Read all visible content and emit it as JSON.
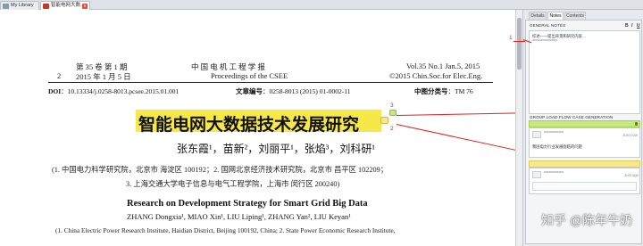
{
  "tabs": [
    {
      "label": "My Library"
    },
    {
      "label": "智能电网大数…",
      "close": "x"
    }
  ],
  "paper": {
    "header_left_vol": "第 35 卷 第 1 期",
    "header_left_date": "2015 年 1 月 5 日",
    "header_page": "2",
    "header_center_cn": "中  国  电  机  工  程  学  报",
    "header_center_en": "Proceedings of the CSEE",
    "header_right_vol": "Vol.35 No.1   Jan.5, 2015",
    "header_right_copy": "©2015 Chin.Soc.for Elec.Eng.",
    "doi_label": "DOI",
    "doi": "：10.13334/j.0258-8013.pcsee.2015.01.001",
    "articleno_label": "文章编号",
    "articleno": "：0258-8013 (2015) 01-0002-11",
    "clc_label": "中图分类号",
    "clc": "：TM 76",
    "title_cn": "智能电网大数据技术发展研究",
    "authors_cn": "张东霞¹，苗新²，刘丽平¹，张焰³，刘科研¹",
    "aff_cn_1": "(1. 中国电力科学研究院，北京市 海淀区 100192；2. 国网北京经济技术研究院，北京市 昌平区 102209；",
    "aff_cn_2": "3. 上海交通大学电子信息与电气工程学院，上海市 闵行区 200240)",
    "title_en": "Research on Development Strategy for Smart Grid Big Data",
    "authors_en": "ZHANG Dongxia¹, MIAO Xin¹, LIU Liping¹, ZHANG Yan², LIU Keyan¹",
    "aff_en": "(1. China Electric Power Research Institute, Haidian District, Beijing 100192, China; 2. State Power Economic Research Institute,"
  },
  "markers": {
    "m1": "1",
    "m2": "2",
    "m3": "3"
  },
  "panel": {
    "tabs": [
      "Details",
      "Notes",
      "Contents"
    ],
    "general_notes_label": "GENERAL NOTES",
    "toolbar": {
      "bold": "B",
      "italic": "I",
      "underline": "U"
    },
    "general_note_text": "综述——提出背景和研究内容…",
    "group_label": "GROUP LOAD FLOW CASE GENERATION",
    "note1_text": "我国电力行业发展面临的问题",
    "note1_time": "Just now",
    "note2_time": "Just ago"
  },
  "watermark": "知乎 @陈年牛奶",
  "colors": {
    "highlight": "#f7e84a",
    "annotation_line": "#e02020",
    "note_green": "#c7e87c",
    "note_yellow": "#f6e98c"
  }
}
